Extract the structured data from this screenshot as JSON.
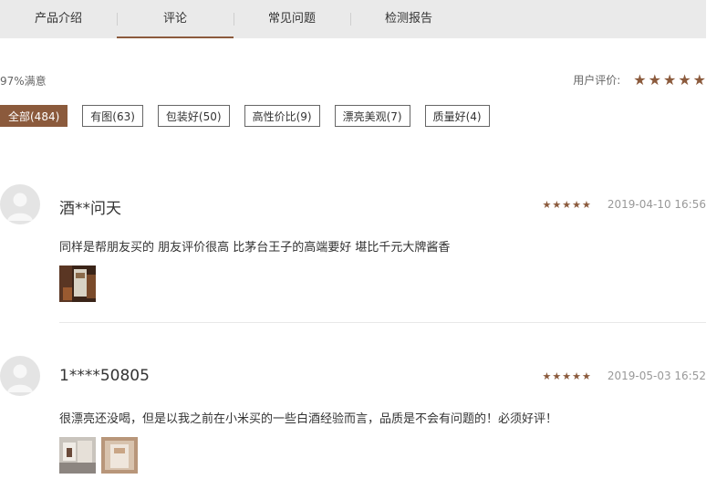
{
  "tabs": [
    {
      "label": "产品介绍"
    },
    {
      "label": "评论"
    },
    {
      "label": "常见问题"
    },
    {
      "label": "检测报告"
    }
  ],
  "summary": {
    "satisfaction": "97%满意",
    "user_rating_label": "用户评价:",
    "rating": 5
  },
  "filters": [
    {
      "label": "全部(484)"
    },
    {
      "label": "有图(63)"
    },
    {
      "label": "包装好(50)"
    },
    {
      "label": "高性价比(9)"
    },
    {
      "label": "漂亮美观(7)"
    },
    {
      "label": "质量好(4)"
    }
  ],
  "reviews": [
    {
      "name": "酒**问天",
      "rating": 5,
      "time": "2019-04-10 16:56",
      "content": "同样是帮朋友买的 朋友评价很高 比茅台王子的高端要好 堪比千元大牌酱香",
      "photo_count": 1
    },
    {
      "name": "1****50805",
      "rating": 5,
      "time": "2019-05-03 16:52",
      "content": "很漂亮还没喝，但是以我之前在小米买的一些白酒经验而言，品质是不会有问题的！必须好评！",
      "photo_count": 2
    }
  ],
  "colors": {
    "accent": "#8b5a3c",
    "tab_bar": "#eaeaea"
  }
}
